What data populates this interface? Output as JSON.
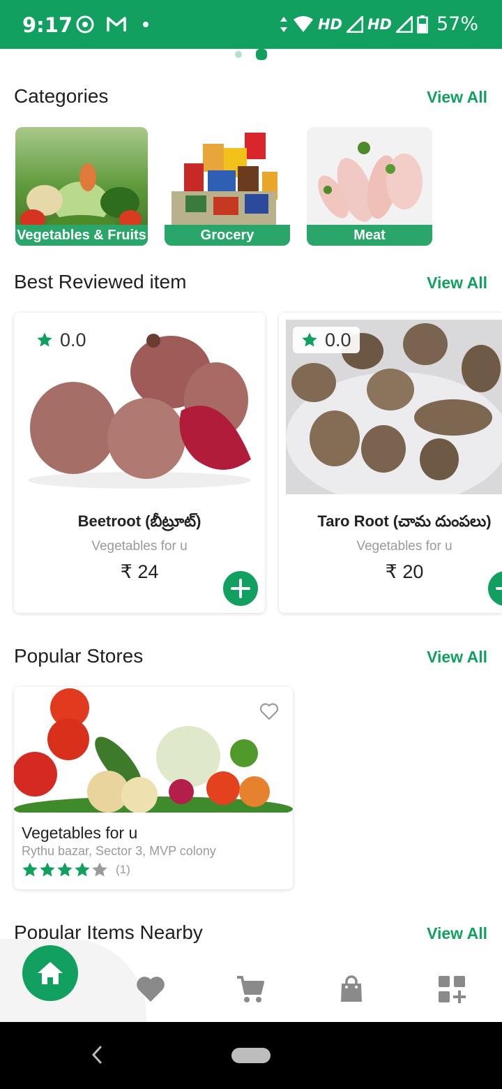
{
  "status_bar": {
    "time": "9:17",
    "network_1": "HD",
    "network_2": "HD",
    "battery": "57%",
    "background_color": "#11a05f"
  },
  "carousel": {
    "pages": 2,
    "active_index": 1
  },
  "categories": {
    "title": "Categories",
    "view_all": "View All",
    "items": [
      {
        "label": "Vegetables & Fruits"
      },
      {
        "label": "Grocery"
      },
      {
        "label": "Meat"
      }
    ]
  },
  "best_reviewed": {
    "title": "Best Reviewed item",
    "view_all": "View All",
    "items": [
      {
        "rating": "0.0",
        "name": "Beetroot (బీట్రూట్)",
        "store": "Vegetables for u",
        "currency": "₹",
        "price": "24"
      },
      {
        "rating": "0.0",
        "name": "Taro Root (చామ దుంపలు)",
        "store": "Vegetables for u",
        "currency": "₹",
        "price": "20"
      }
    ]
  },
  "popular_stores": {
    "title": "Popular Stores",
    "view_all": "View All",
    "items": [
      {
        "name": "Vegetables for u",
        "address": "Rythu bazar, Sector 3, MVP colony",
        "rating": 4,
        "max_rating": 5,
        "review_count": "(1)"
      }
    ]
  },
  "popular_items_nearby": {
    "title": "Popular Items Nearby",
    "view_all": "View All"
  },
  "bottom_nav": {
    "items": [
      "home-icon",
      "heart-icon",
      "cart-icon",
      "shopping-bag-icon",
      "grid-plus-icon"
    ],
    "active_index": 0
  },
  "colors": {
    "accent": "#11a05f",
    "muted_text": "#9a9a9a",
    "icon_gray": "#8a8a8a"
  }
}
